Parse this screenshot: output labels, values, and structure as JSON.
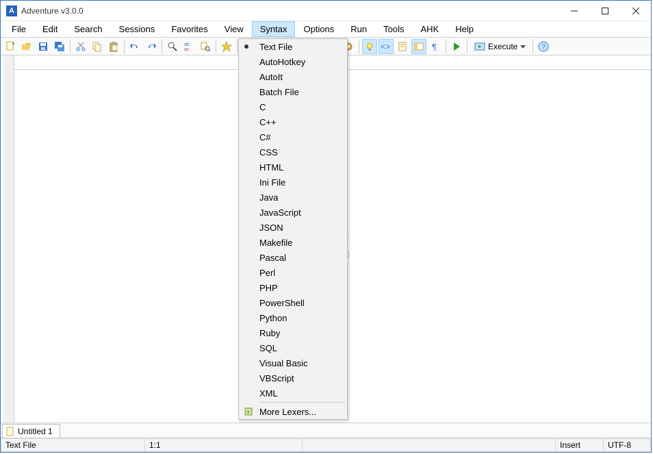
{
  "title": "Adventure v3.0.0",
  "app_icon_letter": "A",
  "menubar": [
    "File",
    "Edit",
    "Search",
    "Sessions",
    "Favorites",
    "View",
    "Syntax",
    "Options",
    "Run",
    "Tools",
    "AHK",
    "Help"
  ],
  "active_menu": "Syntax",
  "syntax_menu": {
    "selected": "Text File",
    "items": [
      "Text File",
      "AutoHotkey",
      "AutoIt",
      "Batch File",
      "C",
      "C++",
      "C#",
      "CSS",
      "HTML",
      "Ini File",
      "Java",
      "JavaScript",
      "JSON",
      "Makefile",
      "Pascal",
      "Perl",
      "PHP",
      "PowerShell",
      "Python",
      "Ruby",
      "SQL",
      "Visual Basic",
      "VBScript",
      "XML"
    ],
    "more": "More Lexers..."
  },
  "toolbar": {
    "execute_label": "Execute"
  },
  "tab": {
    "title": "Untitled 1"
  },
  "statusbar": {
    "lexer": "Text File",
    "position": "1:1",
    "insert": "Insert",
    "encoding": "UTF-8"
  },
  "watermark": "安下载 anxz.com"
}
